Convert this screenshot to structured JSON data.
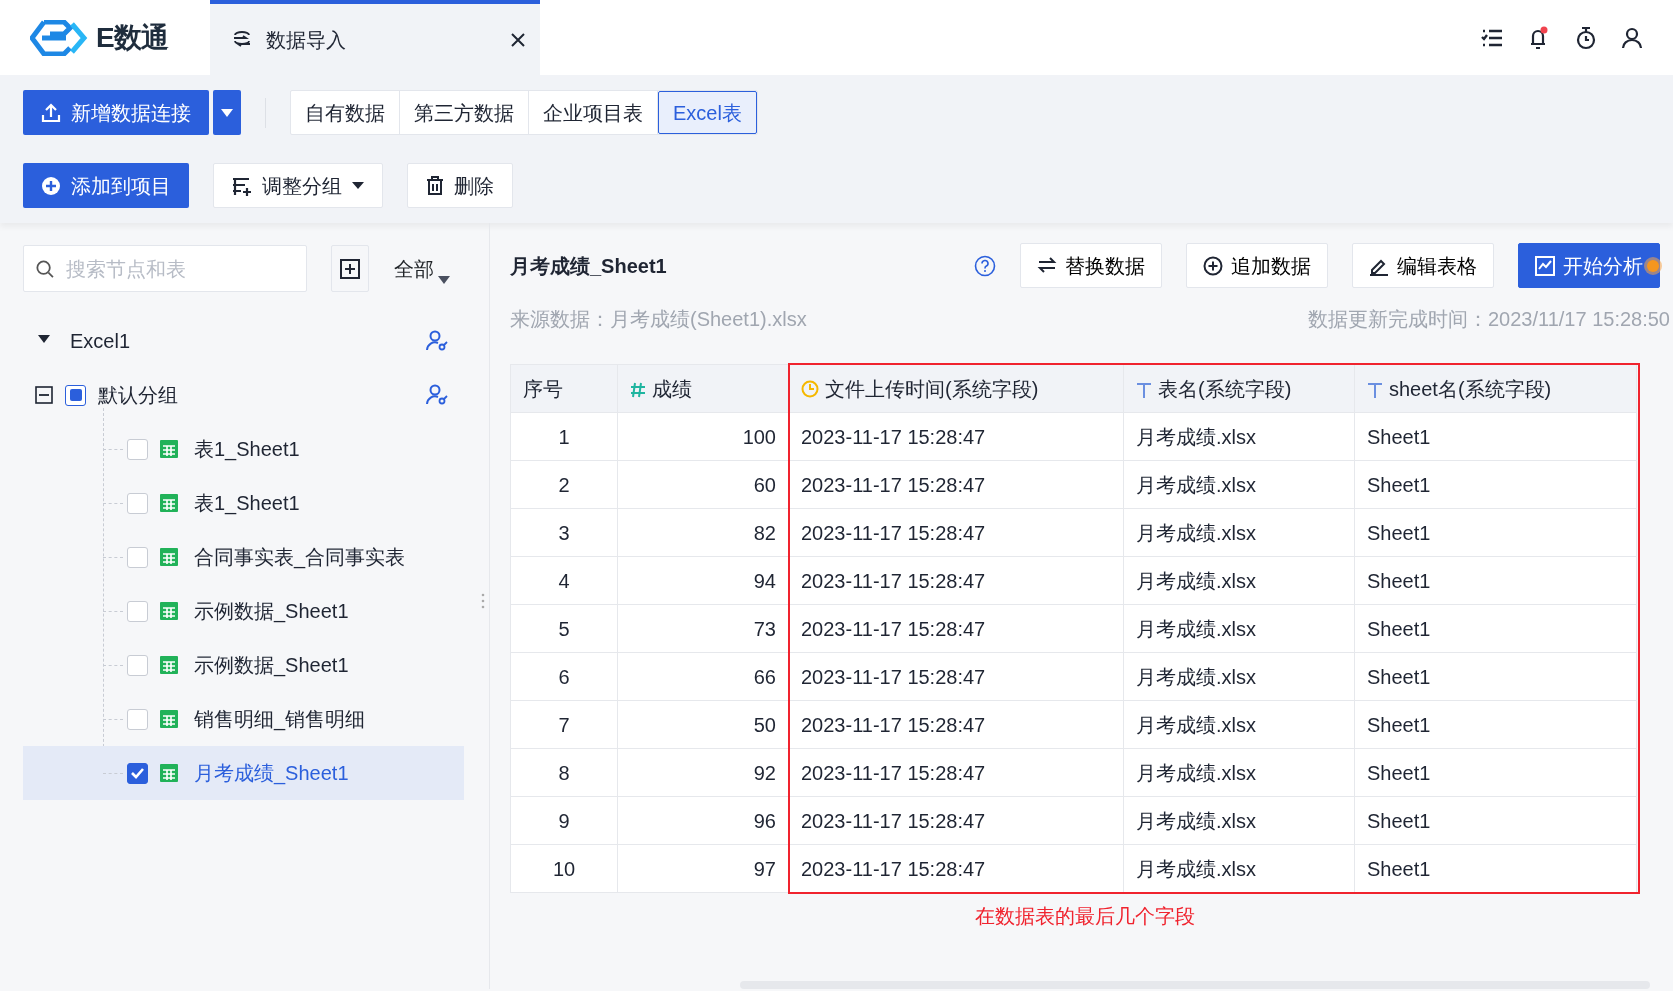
{
  "header": {
    "logo_text": "E数通",
    "tabs": [
      {
        "label": "数据导入",
        "selected": true,
        "closable": true
      }
    ]
  },
  "toolbar": {
    "new_connection_button": "新增数据连接",
    "source_tabs": [
      {
        "label": "自有数据",
        "selected": false
      },
      {
        "label": "第三方数据",
        "selected": false
      },
      {
        "label": "企业项目表",
        "selected": false
      },
      {
        "label": "Excel表",
        "selected": true
      }
    ],
    "add_to_project_button": "添加到项目",
    "group_button": "调整分组",
    "delete_button": "删除"
  },
  "sidebar": {
    "search": {
      "placeholder": "搜索节点和表"
    },
    "filter": "全部",
    "tree": [
      {
        "label": "Excel1",
        "expanded": true,
        "children": [
          {
            "label": "默认分组",
            "expanded": true,
            "checked": false,
            "indeterminate": true,
            "children": [
              {
                "label": "表1_Sheet1",
                "kind": "table",
                "checked": false,
                "selected": false
              },
              {
                "label": "表1_Sheet1",
                "kind": "table",
                "checked": false,
                "selected": false
              },
              {
                "label": "合同事实表_合同事实表",
                "kind": "table",
                "checked": false,
                "selected": false
              },
              {
                "label": "示例数据_Sheet1",
                "kind": "table",
                "checked": false,
                "selected": false
              },
              {
                "label": "示例数据_Sheet1",
                "kind": "table",
                "checked": false,
                "selected": false
              },
              {
                "label": "销售明细_销售明细",
                "kind": "table",
                "checked": false,
                "selected": false
              },
              {
                "label": "月考成绩_Sheet1",
                "kind": "table",
                "checked": true,
                "selected": true
              }
            ]
          }
        ]
      }
    ]
  },
  "detail": {
    "title": "月考成绩_Sheet1",
    "buttons": [
      {
        "label": "替换数据",
        "kind": "replace",
        "primary": false
      },
      {
        "label": "追加数据",
        "kind": "append",
        "primary": false
      },
      {
        "label": "编辑表格",
        "kind": "edit",
        "primary": false
      },
      {
        "label": "开始分析",
        "kind": "analyze",
        "primary": true
      }
    ],
    "source": "来源数据：月考成绩(Sheet1).xlsx",
    "updated": "数据更新完成时间：2023/11/17 15:28:50",
    "table": {
      "columns": [
        {
          "label": "序号",
          "kind": "index",
          "highlighted": false
        },
        {
          "label": "成绩",
          "kind": "number",
          "highlighted": false
        },
        {
          "label": "文件上传时间(系统字段)",
          "kind": "time",
          "highlighted": true
        },
        {
          "label": "表名(系统字段)",
          "kind": "text",
          "highlighted": true
        },
        {
          "label": "sheet名(系统字段)",
          "kind": "text",
          "highlighted": true
        }
      ],
      "rows": [
        [
          "1",
          "100",
          "2023-11-17 15:28:47",
          "月考成绩.xlsx",
          "Sheet1"
        ],
        [
          "2",
          "60",
          "2023-11-17 15:28:47",
          "月考成绩.xlsx",
          "Sheet1"
        ],
        [
          "3",
          "82",
          "2023-11-17 15:28:47",
          "月考成绩.xlsx",
          "Sheet1"
        ],
        [
          "4",
          "94",
          "2023-11-17 15:28:47",
          "月考成绩.xlsx",
          "Sheet1"
        ],
        [
          "5",
          "73",
          "2023-11-17 15:28:47",
          "月考成绩.xlsx",
          "Sheet1"
        ],
        [
          "6",
          "66",
          "2023-11-17 15:28:47",
          "月考成绩.xlsx",
          "Sheet1"
        ],
        [
          "7",
          "50",
          "2023-11-17 15:28:47",
          "月考成绩.xlsx",
          "Sheet1"
        ],
        [
          "8",
          "92",
          "2023-11-17 15:28:47",
          "月考成绩.xlsx",
          "Sheet1"
        ],
        [
          "9",
          "96",
          "2023-11-17 15:28:47",
          "月考成绩.xlsx",
          "Sheet1"
        ],
        [
          "10",
          "97",
          "2023-11-17 15:28:47",
          "月考成绩.xlsx",
          "Sheet1"
        ]
      ]
    },
    "annotation": "在数据表的最后几个字段"
  }
}
